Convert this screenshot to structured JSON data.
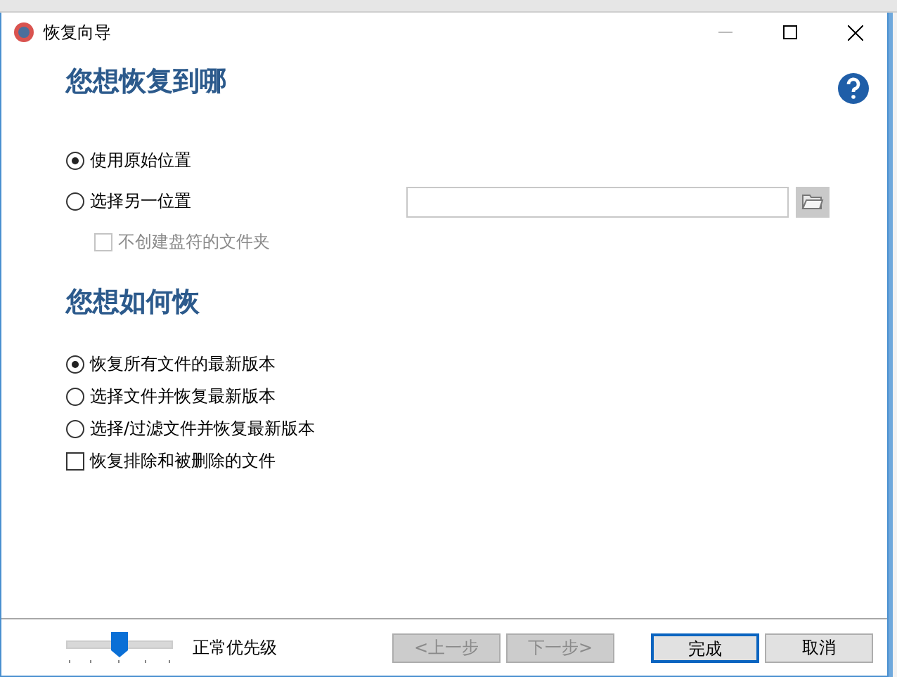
{
  "window": {
    "title": "恢复向导"
  },
  "section_1": {
    "heading": "您想恢复到哪",
    "options": [
      {
        "label": "使用原始位置",
        "selected": true
      },
      {
        "label": "选择另一位置",
        "selected": false
      }
    ],
    "sub_option": {
      "label": "不创建盘符的文件夹",
      "checked": false,
      "disabled": true
    }
  },
  "section_2": {
    "heading": "您想如何恢",
    "options": [
      {
        "kind": "radio",
        "label": "恢复所有文件的最新版本",
        "selected": true
      },
      {
        "kind": "radio",
        "label": "选择文件并恢复最新版本",
        "selected": false
      },
      {
        "kind": "radio",
        "label": "选择/过滤文件并恢复最新版本",
        "selected": false
      },
      {
        "kind": "checkbox",
        "label": "恢复排除和被删除的文件",
        "checked": false
      }
    ]
  },
  "priority": {
    "level": 0.5,
    "label": "正常优先级"
  },
  "buttons": [
    {
      "label": "<上一步",
      "disabled": true,
      "default": false
    },
    {
      "label": "下一步>",
      "disabled": true,
      "default": false
    },
    {
      "label": "完成",
      "disabled": false,
      "default": true
    },
    {
      "label": "取消",
      "disabled": false,
      "default": false
    }
  ]
}
